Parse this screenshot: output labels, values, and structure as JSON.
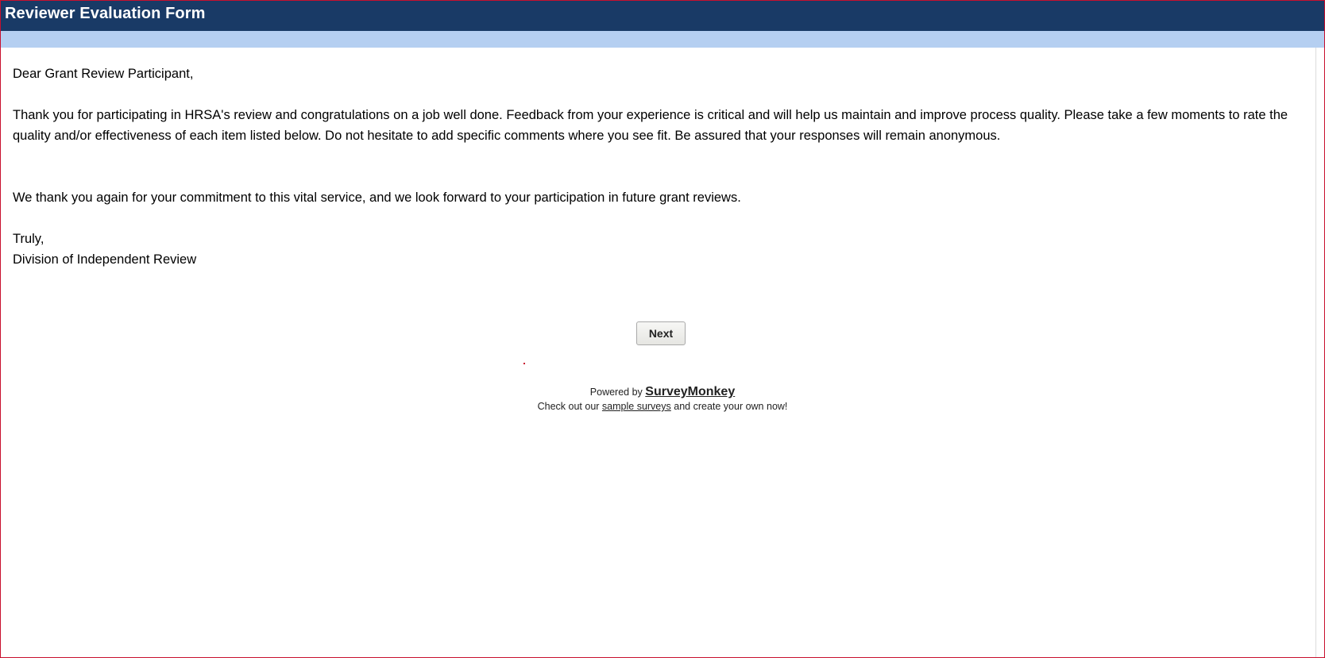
{
  "header": {
    "title": "Reviewer Evaluation Form"
  },
  "intro": {
    "greeting": "Dear Grant Review Participant,",
    "body": "Thank you for participating in HRSA's review and congratulations on a job well done. Feedback from your experience is critical and will help us maintain and improve process quality. Please take a few moments to rate the quality and/or effectiveness of each item listed below. Do not hesitate to add specific comments where you see fit. Be assured that your responses will remain anonymous.",
    "thanks": "We thank you again for your commitment to this vital service, and we look forward to your participation in future grant reviews.",
    "closing": "Truly,",
    "signature": "Division of Independent Review"
  },
  "navigation": {
    "next_label": "Next"
  },
  "footer": {
    "powered_by": "Powered by",
    "brand": "SurveyMonkey",
    "check_out": "Check out our",
    "sample_link": "sample surveys",
    "create_text": "and create your own now!"
  },
  "colors": {
    "title_bar": "#193a66",
    "sub_bar": "#b5cff1",
    "frame_border": "#c8102e",
    "title_text": "#ffffff"
  }
}
